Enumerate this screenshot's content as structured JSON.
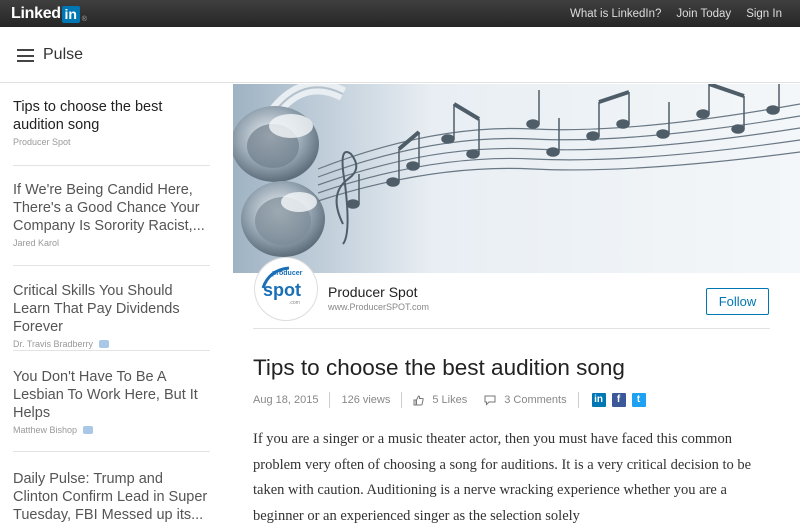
{
  "topbar": {
    "logo_text": "Linked",
    "logo_in": "in",
    "logo_reg": "®",
    "nav": [
      "What is LinkedIn?",
      "Join Today",
      "Sign In"
    ]
  },
  "header": {
    "title": "Pulse"
  },
  "sidebar": {
    "items": [
      {
        "title": "Tips to choose the best audition song",
        "author": "Producer Spot",
        "active": true
      },
      {
        "title": "If We're Being Candid Here, There's a Good Chance Your Company Is Sorority Racist,...",
        "author": "Jared Karol"
      },
      {
        "title": "Critical Skills You Should Learn That Pay Dividends Forever",
        "author": "Dr. Travis Bradberry"
      },
      {
        "title": "You Don't Have To Be A Lesbian To Work Here, But It Helps",
        "author": "Matthew Bishop"
      },
      {
        "title": "Daily Pulse: Trump and Clinton Confirm Lead in Super Tuesday, FBI Messed up its..."
      }
    ]
  },
  "author": {
    "logo_top": "producer",
    "logo_main": "spot",
    "logo_sub": ".com",
    "name": "Producer Spot",
    "url": "www.ProducerSPOT.com",
    "follow_label": "Follow"
  },
  "article": {
    "title": "Tips to choose the best audition song",
    "date": "Aug 18, 2015",
    "views": "126 views",
    "likes": "5 Likes",
    "comments": "3 Comments",
    "share": {
      "linkedin": "in",
      "facebook": "f",
      "twitter": "t"
    },
    "body": "If you are a singer or a music theater actor, then you must have faced this common problem very often of choosing a song for auditions. It is a very critical decision to be taken with caution. Auditioning is a nerve wracking experience whether you are a beginner or an experienced singer as the selection solely"
  },
  "colors": {
    "linkedin_blue": "#0077b5",
    "facebook_blue": "#3b5998",
    "twitter_blue": "#1da1f2"
  }
}
